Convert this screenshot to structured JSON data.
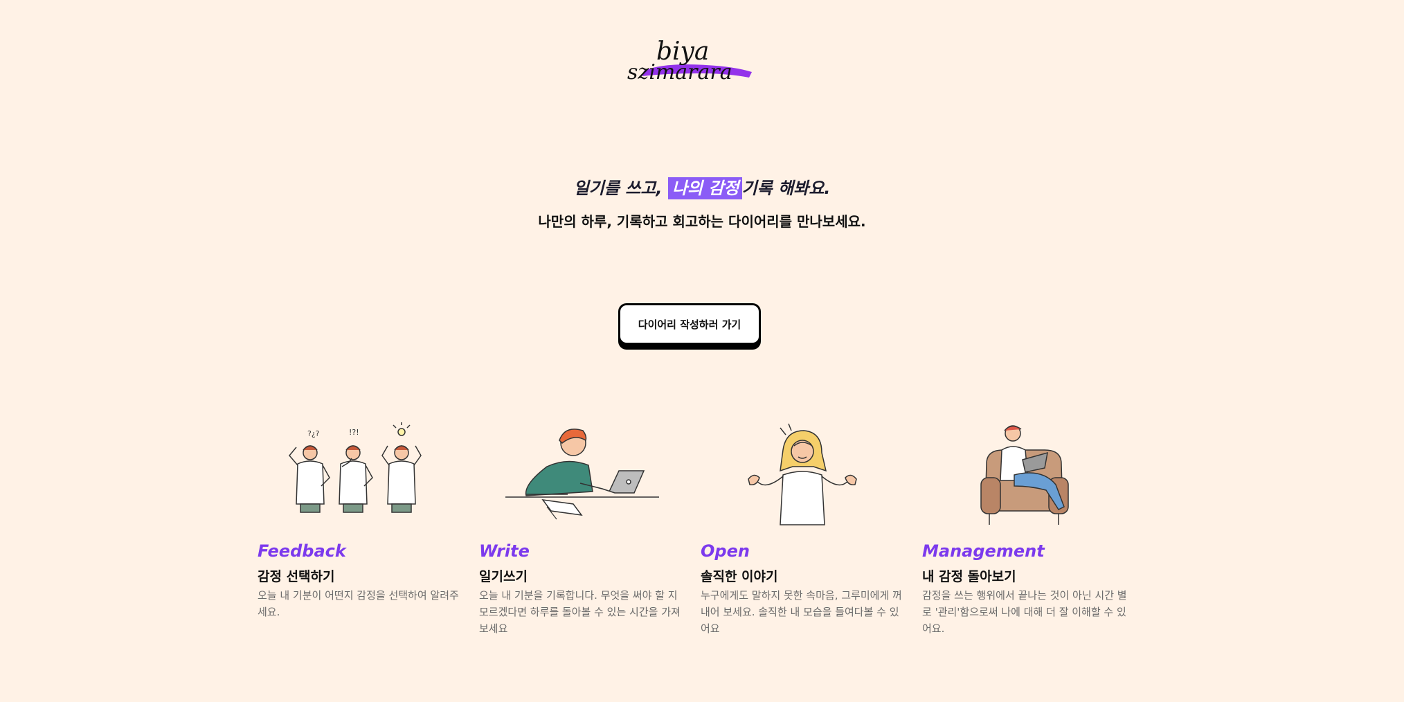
{
  "logo": {
    "line1": "biya",
    "line2": "szimarara",
    "accent_color": "#9333ea"
  },
  "hero": {
    "title_before": "일기를 쓰고, ",
    "title_highlight": "나의 감정",
    "title_after": "기록 해봐요.",
    "subtitle": "나만의 하루, 기록하고 회고하는 다이어리를 만나보세요."
  },
  "cta": {
    "label": "다이어리 작성하러 가기"
  },
  "features": [
    {
      "tag": "Feedback",
      "title": "감정 선택하기",
      "description": "오늘 내 기분이 어떤지 감정을 선택하여 알려주세요.",
      "illustration": "thinking-people-illustration"
    },
    {
      "tag": "Write",
      "title": "일기쓰기",
      "description": "오늘 내 기분을 기록합니다. 무엇을 써야 할 지 모르겠다면 하루를 돌아볼 수 있는 시간을 가져보세요",
      "illustration": "person-laptop-illustration"
    },
    {
      "tag": "Open",
      "title": "솔직한 이야기",
      "description": "누구에게도 말하지 못한 속마음, 그루미에게 꺼내어 보세요. 솔직한 내 모습을 들여다볼 수 있어요",
      "illustration": "shrugging-woman-illustration"
    },
    {
      "tag": "Management",
      "title": "내 감정 돌아보기",
      "description": "감정을 쓰는 행위에서 끝나는 것이 아닌 시간 별로 '관리'함으로써 나에 대해 더 잘 이해할 수 있어요.",
      "illustration": "armchair-laptop-illustration"
    }
  ],
  "colors": {
    "background": "#fff2e6",
    "accent": "#8b5cf6",
    "tag": "#7c3aed"
  }
}
